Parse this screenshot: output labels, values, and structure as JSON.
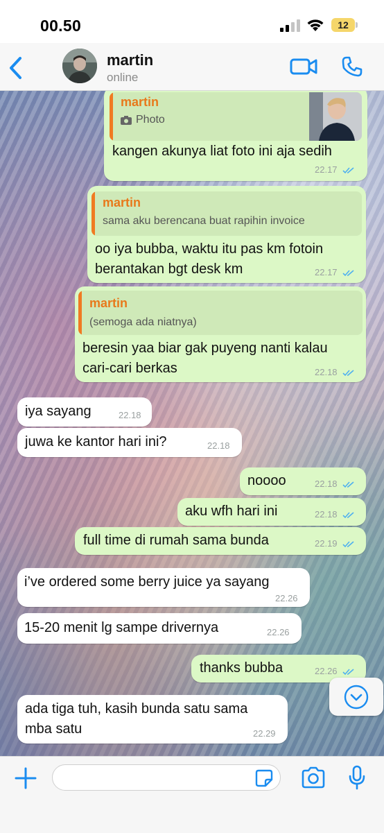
{
  "status_bar": {
    "time": "00.50",
    "battery": "12"
  },
  "header": {
    "contact_name": "martin",
    "contact_status": "online"
  },
  "colors": {
    "accent": "#1a8cf0",
    "outgoing_bubble": "#dcf8c6",
    "incoming_bubble": "#ffffff",
    "quote_name": "#e8791b",
    "read_ticks": "#4fb0f0"
  },
  "messages": [
    {
      "direction": "out",
      "quote": {
        "author": "martin",
        "text": "Photo",
        "has_photo": true
      },
      "text_lines": [
        "kangen akunya liat foto ini aja sedih"
      ],
      "time": "22.17",
      "read": true
    },
    {
      "direction": "out",
      "quote": {
        "author": "martin",
        "text": "sama aku berencana buat rapihin invoice"
      },
      "text_lines": [
        "oo iya bubba, waktu itu pas km fotoin",
        "berantakan bgt desk km"
      ],
      "time": "22.17",
      "read": true
    },
    {
      "direction": "out",
      "quote": {
        "author": "martin",
        "text": "(semoga ada niatnya)"
      },
      "text_lines": [
        "beresin yaa biar gak puyeng nanti kalau",
        "cari-cari berkas"
      ],
      "time": "22.18",
      "read": true
    },
    {
      "direction": "in",
      "text_lines": [
        "iya sayang"
      ],
      "time": "22.18"
    },
    {
      "direction": "in",
      "text_lines": [
        "juwa ke kantor hari ini?"
      ],
      "time": "22.18"
    },
    {
      "direction": "out",
      "text_lines": [
        "noooo"
      ],
      "time": "22.18",
      "read": true
    },
    {
      "direction": "out",
      "text_lines": [
        "aku wfh hari ini"
      ],
      "time": "22.18",
      "read": true
    },
    {
      "direction": "out",
      "text_lines": [
        "full time di rumah sama bunda"
      ],
      "time": "22.19",
      "read": true
    },
    {
      "direction": "in",
      "text_lines": [
        "i’ve ordered some berry juice ya sayang"
      ],
      "time": "22.26"
    },
    {
      "direction": "in",
      "text_lines": [
        "15-20 menit lg sampe drivernya"
      ],
      "time": "22.26"
    },
    {
      "direction": "out",
      "text_lines": [
        "thanks bubba"
      ],
      "time": "22.26",
      "read": true
    },
    {
      "direction": "in",
      "text_lines": [
        "ada tiga tuh, kasih bunda satu sama",
        "mba satu"
      ],
      "time": "22.29"
    }
  ],
  "composer": {
    "placeholder": ""
  }
}
